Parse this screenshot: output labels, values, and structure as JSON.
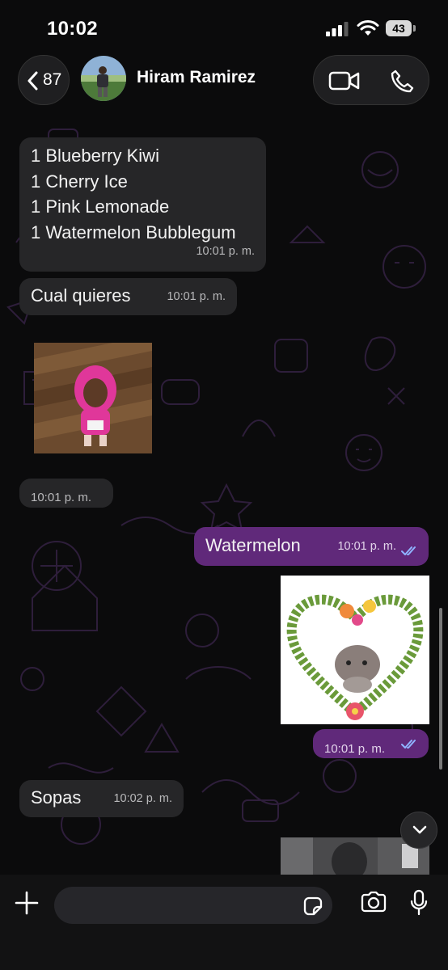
{
  "status_bar": {
    "time": "10:02",
    "battery": "43"
  },
  "header": {
    "back_count": "87",
    "contact_name": "Hiram Ramirez"
  },
  "messages": [
    {
      "direction": "in",
      "lines": [
        "1 Blueberry Kiwi",
        "1 Cherry Ice",
        "1 Pink Lemonade",
        "1 Watermelon Bubblegum"
      ],
      "time": "10:01 p. m."
    },
    {
      "direction": "in",
      "text": "Cual quieres",
      "time": "10:01 p. m."
    },
    {
      "direction": "in",
      "type": "image",
      "time": "10:01 p. m."
    },
    {
      "direction": "out",
      "text": "Watermelon",
      "time": "10:01 p. m.",
      "read": true
    },
    {
      "direction": "out",
      "type": "image",
      "time": "10:01 p. m.",
      "read": true
    },
    {
      "direction": "in",
      "text": "Sopas",
      "time": "10:02 p. m."
    },
    {
      "direction": "out",
      "type": "image"
    }
  ],
  "colors": {
    "outgoing_bubble": "#60297a",
    "incoming_bubble": "#262628",
    "read_ticks": "#8fb4ff"
  },
  "icons": [
    "chevron-left-icon",
    "video-call-icon",
    "phone-icon",
    "chevron-down-icon",
    "plus-icon",
    "sticker-icon",
    "camera-icon",
    "microphone-icon"
  ]
}
